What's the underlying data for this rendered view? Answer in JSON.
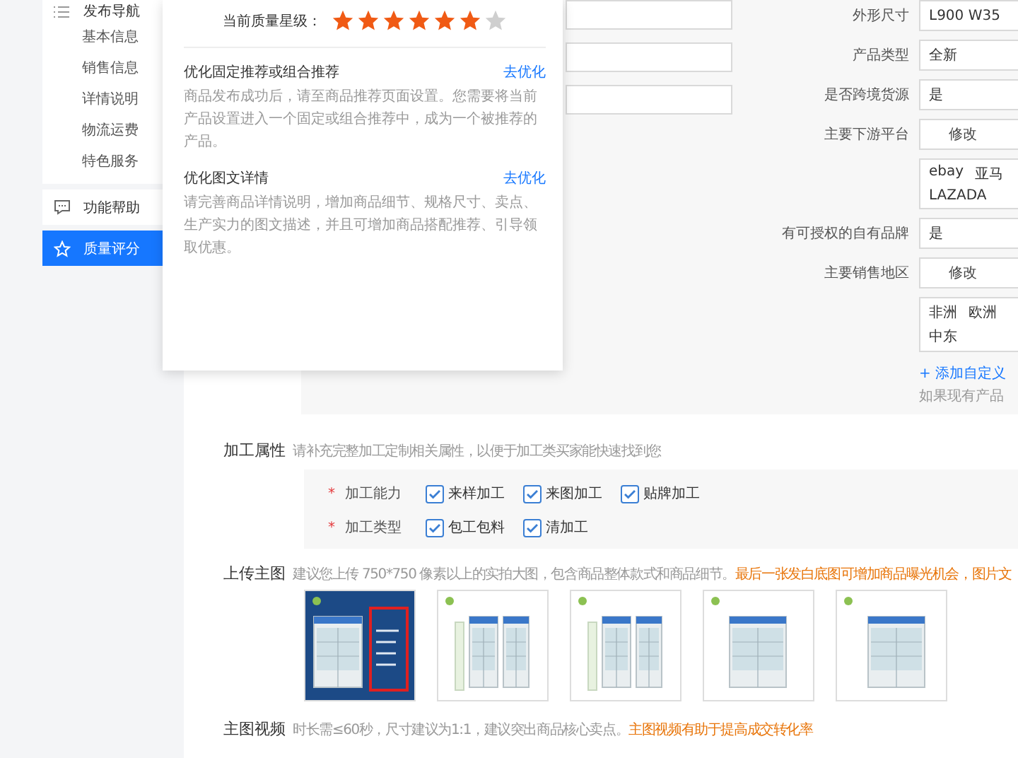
{
  "sidebar": {
    "nav": {
      "label": "发布导航",
      "children": [
        {
          "label": "基本信息"
        },
        {
          "label": "销售信息"
        },
        {
          "label": "详情说明"
        },
        {
          "label": "物流运费"
        },
        {
          "label": "特色服务"
        }
      ]
    },
    "items": [
      {
        "label": "功能帮助",
        "kind": "help",
        "selected": false
      },
      {
        "label": "质量评分",
        "kind": "score",
        "selected": true
      }
    ]
  },
  "quality_popup": {
    "rating_label": "当前质量星级：",
    "stars": 6,
    "tips": [
      {
        "title": "优化固定推荐或组合推荐",
        "action": "去优化",
        "description": "商品发布成功后，请至商品推荐页面设置。您需要将当前产品设置进入一个固定或组合推荐中，成为一个被推荐的产品。"
      },
      {
        "title": "优化图文详情",
        "action": "去优化",
        "description": "请完善商品详情说明，增加商品细节、规格尺寸、卖点、生产实力的图文描述，并且可增加商品搭配推荐、引导领取优惠。"
      }
    ]
  },
  "attributes": {
    "left_fields": [
      {
        "kind": "input"
      },
      {
        "kind": "input"
      },
      {
        "kind": "input"
      }
    ],
    "right_fields": [
      {
        "kind": "input",
        "label": "外形尺寸",
        "value": "L900 W35"
      },
      {
        "kind": "input",
        "label": "产品类型",
        "value": "全新"
      },
      {
        "kind": "input",
        "label": "是否跨境货源",
        "value": "是"
      },
      {
        "kind": "button",
        "label": "主要下游平台",
        "value": "修改"
      },
      {
        "kind": "tags",
        "lines": [
          [
            "ebay",
            "亚马"
          ],
          [
            "LAZADA"
          ]
        ]
      },
      {
        "kind": "input",
        "label": "有可授权的自有品牌",
        "value": "是"
      },
      {
        "kind": "button",
        "label": "主要销售地区",
        "value": "修改"
      },
      {
        "kind": "tags",
        "lines": [
          [
            "非洲",
            "欧洲"
          ],
          [
            "中东"
          ]
        ]
      }
    ],
    "add_link": "+ 添加自定义",
    "note": "如果现有产品"
  },
  "processing": {
    "label": "加工属性",
    "hint": "请补充完整加工定制相关属性，以便于加工类买家能快速找到您",
    "rows": [
      {
        "label": "加工能力",
        "required_mark": "*",
        "options": [
          {
            "label": "来样加工",
            "checked": true
          },
          {
            "label": "来图加工",
            "checked": true
          },
          {
            "label": "贴牌加工",
            "checked": true
          }
        ]
      },
      {
        "label": "加工类型",
        "required_mark": "*",
        "options": [
          {
            "label": "包工包料",
            "checked": true
          },
          {
            "label": "清加工",
            "checked": true
          }
        ]
      }
    ]
  },
  "upload": {
    "label": "上传主图",
    "hint": "建议您上传 750*750 像素以上的实拍大图，包含商品整体款式和商品细节。",
    "highlight": "最后一张发白底图可增加商品曝光机会，图片文"
  },
  "video": {
    "label": "主图视频",
    "hint": "时长需≤60秒，尺寸建议为1:1，建议突出商品核心卖点。",
    "highlight": "主图视频有助于提高成交转化率"
  }
}
